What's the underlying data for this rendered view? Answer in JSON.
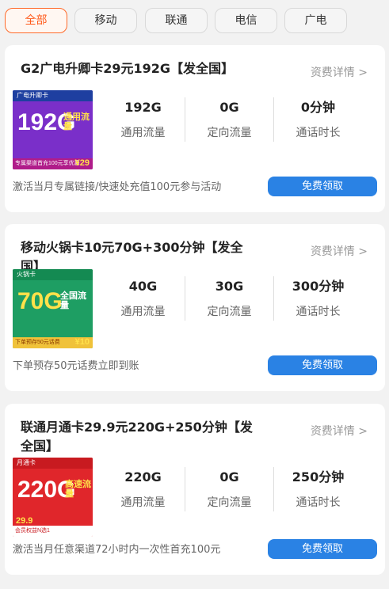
{
  "tabs": [
    {
      "label": "全部",
      "active": true
    },
    {
      "label": "移动",
      "active": false
    },
    {
      "label": "联通",
      "active": false
    },
    {
      "label": "电信",
      "active": false
    },
    {
      "label": "广电",
      "active": false
    }
  ],
  "cards": [
    {
      "title": "G2广电升卿卡29元192G【发全国】",
      "details": "资费详情 >",
      "stats": [
        {
          "value": "192G",
          "label": "通用流量"
        },
        {
          "value": "0G",
          "label": "定向流量"
        },
        {
          "value": "0分钟",
          "label": "通话时长"
        }
      ],
      "note": "激活当月专属链接/快速处充值100元参与活动",
      "button": "免费领取",
      "thumb": {
        "big": "192G",
        "tag": "通用流量",
        "price": "¥29",
        "head": "广电升卿卡",
        "foot": "专属渠道首充100元享优惠"
      }
    },
    {
      "title": "移动火锅卡10元70G+300分钟【发全国】",
      "details": "资费详情 >",
      "stats": [
        {
          "value": "40G",
          "label": "通用流量"
        },
        {
          "value": "30G",
          "label": "定向流量"
        },
        {
          "value": "300分钟",
          "label": "通话时长"
        }
      ],
      "note": "下单预存50元话费立即到账",
      "button": "免费领取",
      "thumb": {
        "big": "70G",
        "tag": "全国流量",
        "price": "¥10",
        "head": "火锅卡",
        "foot": "下单预存50元话费"
      }
    },
    {
      "title": "联通月通卡29.9元220G+250分钟【发全国】",
      "details": "资费详情 >",
      "stats": [
        {
          "value": "220G",
          "label": "通用流量"
        },
        {
          "value": "0G",
          "label": "定向流量"
        },
        {
          "value": "250分钟",
          "label": "通话时长"
        }
      ],
      "note": "激活当月任意渠道72小时内一次性首充100元",
      "button": "免费领取",
      "thumb": {
        "big": "220G",
        "tag": "高速流量",
        "price": "29.9",
        "head": "月通卡",
        "foot": "会员权益N选1"
      }
    }
  ],
  "colors": {
    "accent": "#ff6a2a",
    "button": "#2a82e4",
    "card1": "#7a2fc9",
    "card2": "#1e9e63",
    "card3": "#e0262b"
  }
}
